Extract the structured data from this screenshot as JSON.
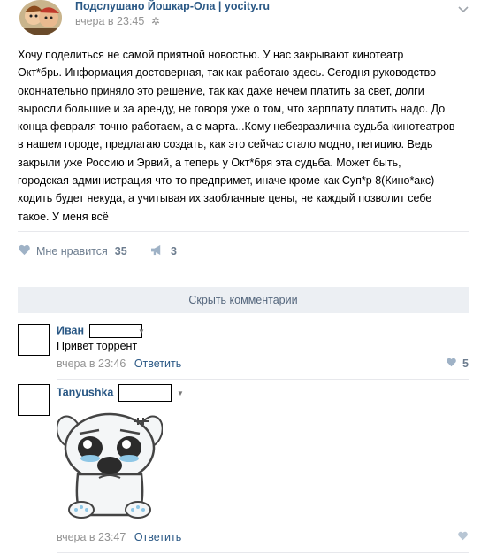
{
  "post": {
    "community_name": "Подслушано Йошкар-Ола | yocity.ru",
    "time": "вчера в 23:45",
    "text": "Хочу поделиться не самой приятной новостью. У нас закрывают кинотеатр\nОкт*брь. Информация достоверная, так как работаю здесь. Сегодня руководство\nокончательно приняло это решение, так как даже нечем платить за свет, долги\nвыросли большие и за аренду, не говоря уже о том, что зарплату платить надо. До\nконца февраля точно работаем, а с марта...Кому небезразлична судьба кинотеатров\nв нашем городе, предлагаю создать, как это сейчас стало модно, петицию. Ведь\nзакрыли уже Россию и Эрвий, а теперь у Окт*бря эта судьба. Может быть,\nгородская администрация что-то предпримет, иначе кроме как Суп*р 8(Кино*акс)\nходить будет некуда, а учитывая их заоблачные цены, не каждый позволит себе\nтакое. У меня всё",
    "like_label": "Мне нравится",
    "like_count": "35",
    "share_count": "3"
  },
  "comments_toggle": "Скрыть комментарии",
  "comments": [
    {
      "author": "Иван",
      "text": "Привет торрент",
      "time": "вчера в 23:46",
      "reply": "Ответить",
      "likes": "5"
    },
    {
      "author": "Tanyushka",
      "time": "вчера в 23:47",
      "reply": "Ответить"
    }
  ],
  "icons": {
    "post_menu": "chevron-down-icon",
    "settings": "gear-icon",
    "like": "heart-icon",
    "share": "megaphone-icon",
    "author_menu": "caret-down-icon",
    "sticker": "sad-dog-sticker"
  },
  "colors": {
    "link": "#2a5885",
    "meta": "#939393",
    "action": "#6d7d8f",
    "button_bg": "#eceff3",
    "divider": "#e7e8ec"
  }
}
